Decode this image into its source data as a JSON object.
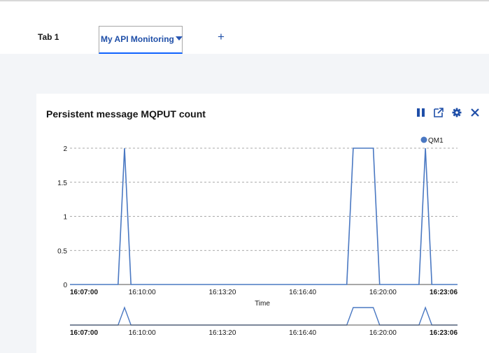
{
  "tabs": [
    {
      "label": "Tab 1"
    },
    {
      "label": "My API Monitoring"
    }
  ],
  "add_tab_label": "+",
  "widget": {
    "title": "Persistent message MQPUT count",
    "toolbar_icons": [
      "pause-icon",
      "launch-icon",
      "settings-icon",
      "close-icon"
    ]
  },
  "colors": {
    "accent": "#0f62fe",
    "series": "#4a78c2",
    "tab_text": "#1f4fa8",
    "canvas_bg": "#f3f5f8"
  },
  "chart_data": {
    "type": "line",
    "xlabel": "Time",
    "ylabel": "",
    "ylim": [
      0,
      2
    ],
    "y_ticks": [
      "0",
      "0.5",
      "1",
      "1.5",
      "2"
    ],
    "x_ticks": [
      "16:07:00",
      "16:10:00",
      "16:13:20",
      "16:16:40",
      "16:20:00",
      "16:23:06"
    ],
    "x_range": [
      "16:07:00",
      "16:23:06"
    ],
    "grid": "horizontal dashed",
    "legend_position": "top-right",
    "series": [
      {
        "name": "QM1",
        "points": [
          [
            "16:07:00",
            0
          ],
          [
            "16:09:00",
            0
          ],
          [
            "16:09:16",
            2
          ],
          [
            "16:09:32",
            0
          ],
          [
            "16:18:30",
            0
          ],
          [
            "16:18:46",
            2
          ],
          [
            "16:19:36",
            2
          ],
          [
            "16:19:52",
            0
          ],
          [
            "16:21:30",
            0
          ],
          [
            "16:21:46",
            2
          ],
          [
            "16:22:02",
            0
          ],
          [
            "16:23:06",
            0
          ]
        ]
      }
    ],
    "overview": {
      "x_ticks": [
        "16:07:00",
        "16:10:00",
        "16:13:20",
        "16:16:40",
        "16:20:00",
        "16:23:06"
      ]
    }
  }
}
